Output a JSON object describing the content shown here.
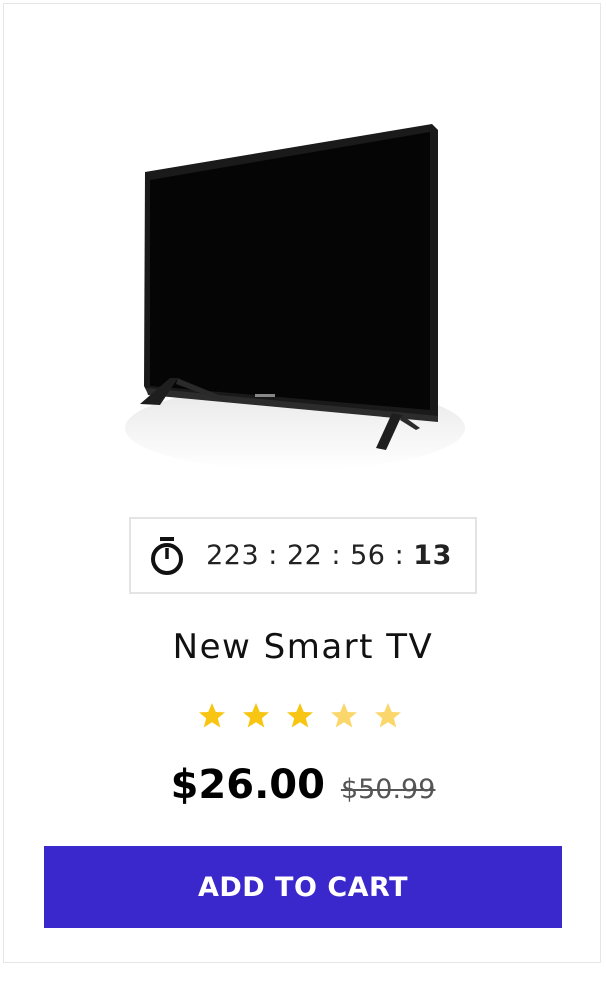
{
  "product": {
    "image_alt": "Smart TV",
    "timer": {
      "days": "223",
      "hours": "22",
      "minutes": "56",
      "seconds": "13",
      "separator": ":"
    },
    "title": "New Smart TV",
    "rating": 5,
    "price_current": "$26.00",
    "price_original": "$50.99",
    "add_to_cart_label": "ADD TO CART"
  },
  "colors": {
    "accent": "#3b28cc",
    "star": "#f8c512",
    "star_light": "#fbd66a"
  },
  "icons": {
    "timer": "stopwatch-icon",
    "star": "star-icon"
  }
}
